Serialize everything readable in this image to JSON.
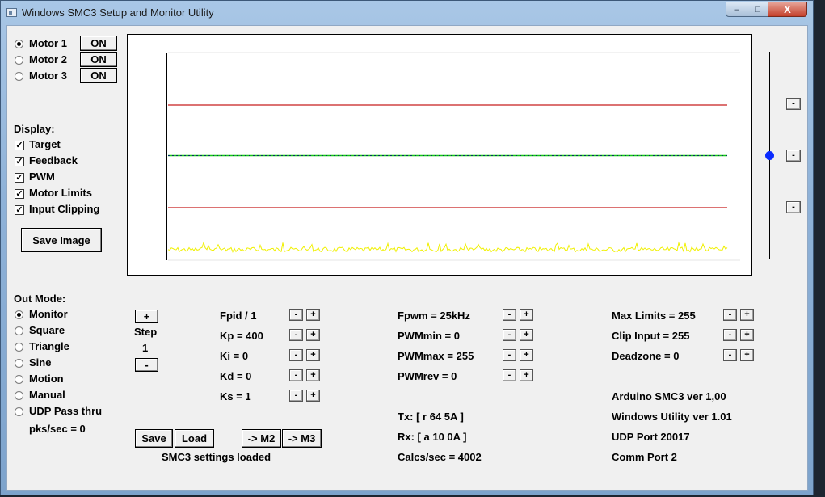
{
  "window": {
    "title": "Windows SMC3 Setup and Monitor Utility",
    "minimize": "–",
    "maximize": "□",
    "close": "X"
  },
  "motors": [
    {
      "label": "Motor 1",
      "toggle": "ON",
      "selected": true
    },
    {
      "label": "Motor 2",
      "toggle": "ON",
      "selected": false
    },
    {
      "label": "Motor 3",
      "toggle": "ON",
      "selected": false
    }
  ],
  "display": {
    "heading": "Display:",
    "options": [
      {
        "label": "Target",
        "checked": true
      },
      {
        "label": "Feedback",
        "checked": true
      },
      {
        "label": "PWM",
        "checked": true
      },
      {
        "label": "Motor Limits",
        "checked": true
      },
      {
        "label": "Input Clipping",
        "checked": true
      }
    ],
    "save_image": "Save Image"
  },
  "out_mode": {
    "heading": "Out Mode:",
    "options": [
      {
        "label": "Monitor",
        "selected": true
      },
      {
        "label": "Square",
        "selected": false
      },
      {
        "label": "Triangle",
        "selected": false
      },
      {
        "label": "Sine",
        "selected": false
      },
      {
        "label": "Motion",
        "selected": false
      },
      {
        "label": "Manual",
        "selected": false
      },
      {
        "label": "UDP Pass thru",
        "selected": false
      }
    ],
    "pks": "pks/sec = 0"
  },
  "step": {
    "plus": "+",
    "label": "Step",
    "value": "1",
    "minus": "-"
  },
  "pid": [
    {
      "label": "Fpid / 1"
    },
    {
      "label": "Kp = 400"
    },
    {
      "label": "Ki = 0"
    },
    {
      "label": "Kd = 0"
    },
    {
      "label": "Ks = 1"
    }
  ],
  "pwm": [
    {
      "label": "Fpwm = 25kHz"
    },
    {
      "label": "PWMmin = 0"
    },
    {
      "label": "PWMmax = 255"
    },
    {
      "label": "PWMrev = 0"
    }
  ],
  "limits": [
    {
      "label": "Max Limits = 255"
    },
    {
      "label": "Clip Input = 255"
    },
    {
      "label": "Deadzone = 0"
    }
  ],
  "comm": {
    "tx": "Tx: [ r 64 5A ]",
    "rx": "Rx: [ a 10 0A ]",
    "calcs": "Calcs/sec = 4002"
  },
  "info": {
    "arduino": "Arduino SMC3 ver 1,00",
    "utility": "Windows Utility ver 1.01",
    "udp": "UDP Port 20017",
    "comm_port": "Comm Port 2"
  },
  "buttons": {
    "save": "Save",
    "load": "Load",
    "to_m2": "-> M2",
    "to_m3": "-> M3"
  },
  "status": "SMC3 settings loaded",
  "adjust": {
    "minus": "-",
    "plus": "+"
  },
  "slider_buttons": [
    "-",
    "-",
    "-"
  ],
  "colors": {
    "limit_line": "#c81e1e",
    "target": "#0a2a6a",
    "feedback": "#14c814",
    "pwm": "#ffff00",
    "slider_thumb": "#0a2bff"
  }
}
